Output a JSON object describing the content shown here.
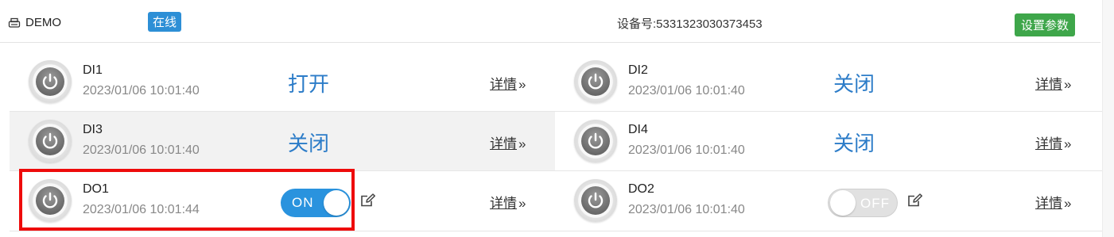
{
  "header": {
    "device_name": "DEMO",
    "online_badge": "在线",
    "serial_label": "设备号:",
    "serial_number": "5331323030373453",
    "settings_button": "设置参数"
  },
  "rows": [
    {
      "left": {
        "name": "DI1",
        "time": "2023/01/06 10:01:40",
        "status": "打开",
        "detail": "详情",
        "arrow": "»"
      },
      "right": {
        "name": "DI2",
        "time": "2023/01/06 10:01:40",
        "status": "关闭",
        "detail": "详情",
        "arrow": "»"
      }
    },
    {
      "left": {
        "name": "DI3",
        "time": "2023/01/06 10:01:40",
        "status": "关闭",
        "detail": "详情",
        "arrow": "»"
      },
      "right": {
        "name": "DI4",
        "time": "2023/01/06 10:01:40",
        "status": "关闭",
        "detail": "详情",
        "arrow": "»"
      }
    },
    {
      "left": {
        "name": "DO1",
        "time": "2023/01/06 10:01:44",
        "toggle": "ON",
        "detail": "详情",
        "arrow": "»"
      },
      "right": {
        "name": "DO2",
        "time": "2023/01/06 10:01:40",
        "toggle": "OFF",
        "detail": "详情",
        "arrow": "»"
      }
    }
  ],
  "colors": {
    "status_text": "#2c7cc8",
    "online_badge": "#2d8fd6",
    "settings_button": "#3ea64a",
    "toggle_on": "#2a93de",
    "highlight": "#ee0b0b"
  },
  "icons": [
    "printer-icon",
    "power-icon",
    "edit-icon"
  ]
}
